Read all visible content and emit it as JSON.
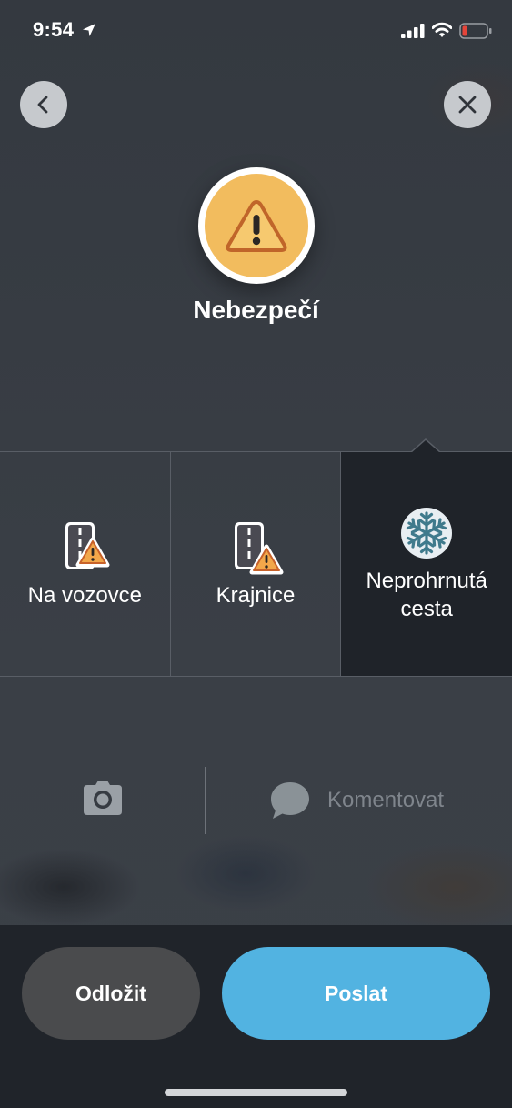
{
  "status_bar": {
    "time": "9:54",
    "icons": [
      "location-arrow-icon",
      "cellular-signal-icon",
      "wifi-icon",
      "battery-low-icon"
    ],
    "battery_color": "#e5453a"
  },
  "header": {
    "back_icon": "chevron-left-icon",
    "close_icon": "close-icon"
  },
  "category": {
    "icon": "warning-triangle-icon",
    "title": "Nebezpečí",
    "accent": "#f2bc5e"
  },
  "options": [
    {
      "label": "Na vozovce",
      "icon": "road-hazard-icon",
      "selected": false
    },
    {
      "label": "Krajnice",
      "icon": "shoulder-hazard-icon",
      "selected": false
    },
    {
      "label_line1": "Neprohrnutá",
      "label_line2": "cesta",
      "icon": "snowflake-icon",
      "selected": true
    }
  ],
  "attachments": {
    "camera_icon": "camera-icon",
    "comment_icon": "speech-bubble-icon",
    "comment_placeholder": "Komentovat"
  },
  "actions": {
    "later_label": "Odložit",
    "send_label": "Poslat",
    "send_color": "#52b3e1"
  }
}
